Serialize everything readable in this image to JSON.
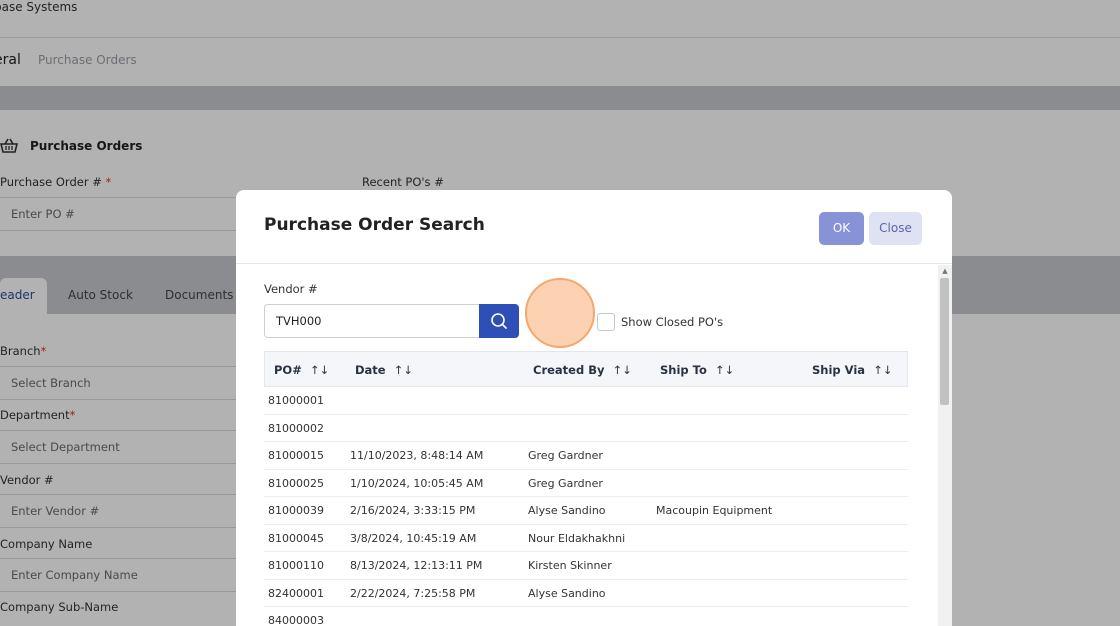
{
  "background": {
    "app_title": "base Systems",
    "breadcrumb_current": "eral",
    "breadcrumb_link": "Purchase Orders",
    "section_title": "Purchase Orders",
    "po_label": "Purchase Order #",
    "po_placeholder": "Enter PO #",
    "recent_label": "Recent PO's #",
    "tabs": [
      {
        "label": "eader"
      },
      {
        "label": "Auto Stock"
      },
      {
        "label": "Documents"
      }
    ],
    "fields": [
      {
        "label": "Branch",
        "required": "*",
        "placeholder": "Select Branch"
      },
      {
        "label": "Department",
        "required": "*",
        "placeholder": "Select Department"
      },
      {
        "label": "Vendor #",
        "required": "",
        "placeholder": "Enter Vendor #"
      },
      {
        "label": "Company Name",
        "required": "",
        "placeholder": "Enter Company Name"
      },
      {
        "label": "Company Sub-Name",
        "required": "",
        "placeholder": ""
      }
    ]
  },
  "modal": {
    "title": "Purchase Order Search",
    "ok_label": "OK",
    "close_label": "Close",
    "vendor_label": "Vendor #",
    "vendor_value": "TVH000",
    "show_closed_label": "Show Closed PO's",
    "sort_glyph": "↑↓",
    "columns": [
      "PO#",
      "Date",
      "Created By",
      "Ship To",
      "Ship Via"
    ],
    "rows": [
      {
        "po": "81000001",
        "date": "",
        "created_by": "",
        "ship_to": "",
        "ship_via": ""
      },
      {
        "po": "81000002",
        "date": "",
        "created_by": "",
        "ship_to": "",
        "ship_via": ""
      },
      {
        "po": "81000015",
        "date": "11/10/2023, 8:48:14 AM",
        "created_by": "Greg Gardner",
        "ship_to": "",
        "ship_via": ""
      },
      {
        "po": "81000025",
        "date": "1/10/2024, 10:05:45 AM",
        "created_by": "Greg Gardner",
        "ship_to": "",
        "ship_via": ""
      },
      {
        "po": "81000039",
        "date": "2/16/2024, 3:33:15 PM",
        "created_by": "Alyse Sandino",
        "ship_to": "Macoupin Equipment",
        "ship_via": ""
      },
      {
        "po": "81000045",
        "date": "3/8/2024, 10:45:19 AM",
        "created_by": "Nour Eldakhakhni",
        "ship_to": "",
        "ship_via": ""
      },
      {
        "po": "81000110",
        "date": "8/13/2024, 12:13:11 PM",
        "created_by": "Kirsten Skinner",
        "ship_to": "",
        "ship_via": ""
      },
      {
        "po": "82400001",
        "date": "2/22/2024, 7:25:58 PM",
        "created_by": "Alyse Sandino",
        "ship_to": "",
        "ship_via": ""
      },
      {
        "po": "84000003",
        "date": "",
        "created_by": "",
        "ship_to": "",
        "ship_via": ""
      }
    ]
  },
  "colors": {
    "primary": "#2e4fb5",
    "ok_button": "#8892d6",
    "close_button_bg": "#dfe2f3",
    "click_marker": "#fdd2b3"
  },
  "icons": {
    "section": "basket-icon",
    "search": "search-icon"
  }
}
